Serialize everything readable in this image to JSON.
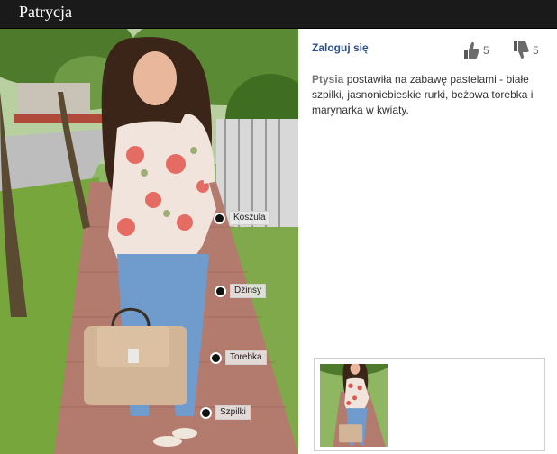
{
  "header": {
    "title": "Patrycja"
  },
  "login_link": "Zaloguj się",
  "votes": {
    "likes": "5",
    "dislikes": "5"
  },
  "description": {
    "author": "Ptysia",
    "text": " postawiła na zabawę pastelami - białe szpilki, jasnoniebieskie rurki, beżowa torebka i marynarka w kwiaty."
  },
  "photo_tags": [
    {
      "label": "Koszula"
    },
    {
      "label": "Dżinsy"
    },
    {
      "label": "Torebka"
    },
    {
      "label": "Szpilki"
    }
  ],
  "colors": {
    "header_bg": "#1a1a1a",
    "link": "#2f4f8f",
    "author": "#777777"
  }
}
